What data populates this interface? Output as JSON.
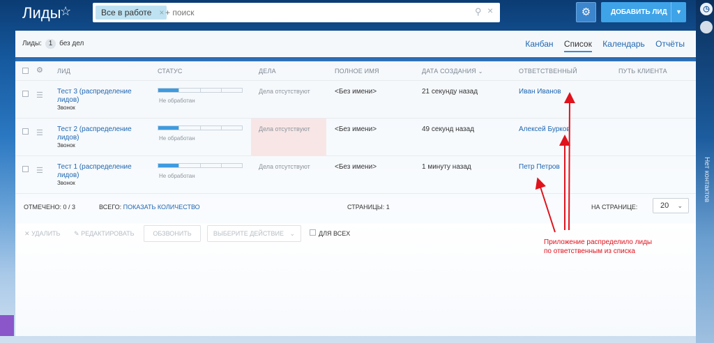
{
  "header": {
    "title": "Лиды",
    "filter_chip": "Все в работе",
    "search_placeholder": "+ поиск",
    "add_button": "ДОБАВИТЬ ЛИД"
  },
  "topbar": {
    "leads_label": "Лиды:",
    "leads_count": "1",
    "leads_suffix": "без дел",
    "tabs": [
      "Канбан",
      "Список",
      "Календарь",
      "Отчёты"
    ],
    "active_tab": "Список"
  },
  "table": {
    "columns": [
      "ЛИД",
      "СТАТУС",
      "ДЕЛА",
      "ПОЛНОЕ ИМЯ",
      "ДАТА СОЗДАНИЯ",
      "ОТВЕТСТВЕННЫЙ",
      "ПУТЬ КЛИЕНТА"
    ],
    "rows": [
      {
        "name": "Тест 3 (распределение лидов)",
        "source": "Звонок",
        "status": "Не обработан",
        "status_progress": 0.25,
        "cases": "Дела отсутствуют",
        "cases_highlight": false,
        "fullname": "<Без имени>",
        "created": "21 секунду назад",
        "responsible": "Иван Иванов"
      },
      {
        "name": "Тест 2 (распределение лидов)",
        "source": "Звонок",
        "status": "Не обработан",
        "status_progress": 0.25,
        "cases": "Дела отсутствуют",
        "cases_highlight": true,
        "fullname": "<Без имени>",
        "created": "49 секунд назад",
        "responsible": "Алексей Бурков"
      },
      {
        "name": "Тест 1 (распределение лидов)",
        "source": "Звонок",
        "status": "Не обработан",
        "status_progress": 0.25,
        "cases": "Дела отсутствуют",
        "cases_highlight": false,
        "fullname": "<Без имени>",
        "created": "1 минуту назад",
        "responsible": "Петр Петров"
      }
    ]
  },
  "footer": {
    "selected": "ОТМЕЧЕНО: 0 / 3",
    "total_label": "ВСЕГО:",
    "total_link": "ПОКАЗАТЬ КОЛИЧЕСТВО",
    "pages": "СТРАНИЦЫ: 1",
    "per_page_label": "НА СТРАНИЦЕ:",
    "per_page_value": "20"
  },
  "actions": {
    "delete": "УДАЛИТЬ",
    "edit": "РЕДАКТИРОВАТЬ",
    "call": "ОБЗВОНИТЬ",
    "select_action": "ВЫБЕРИТЕ ДЕЙСТВИЕ",
    "for_all": "ДЛЯ ВСЕХ"
  },
  "annotation": {
    "line1": "Приложение распределило лиды",
    "line2": "по ответственным из списка",
    "color": "#e0121c"
  },
  "side_panel": {
    "text": "Нет контактов"
  }
}
